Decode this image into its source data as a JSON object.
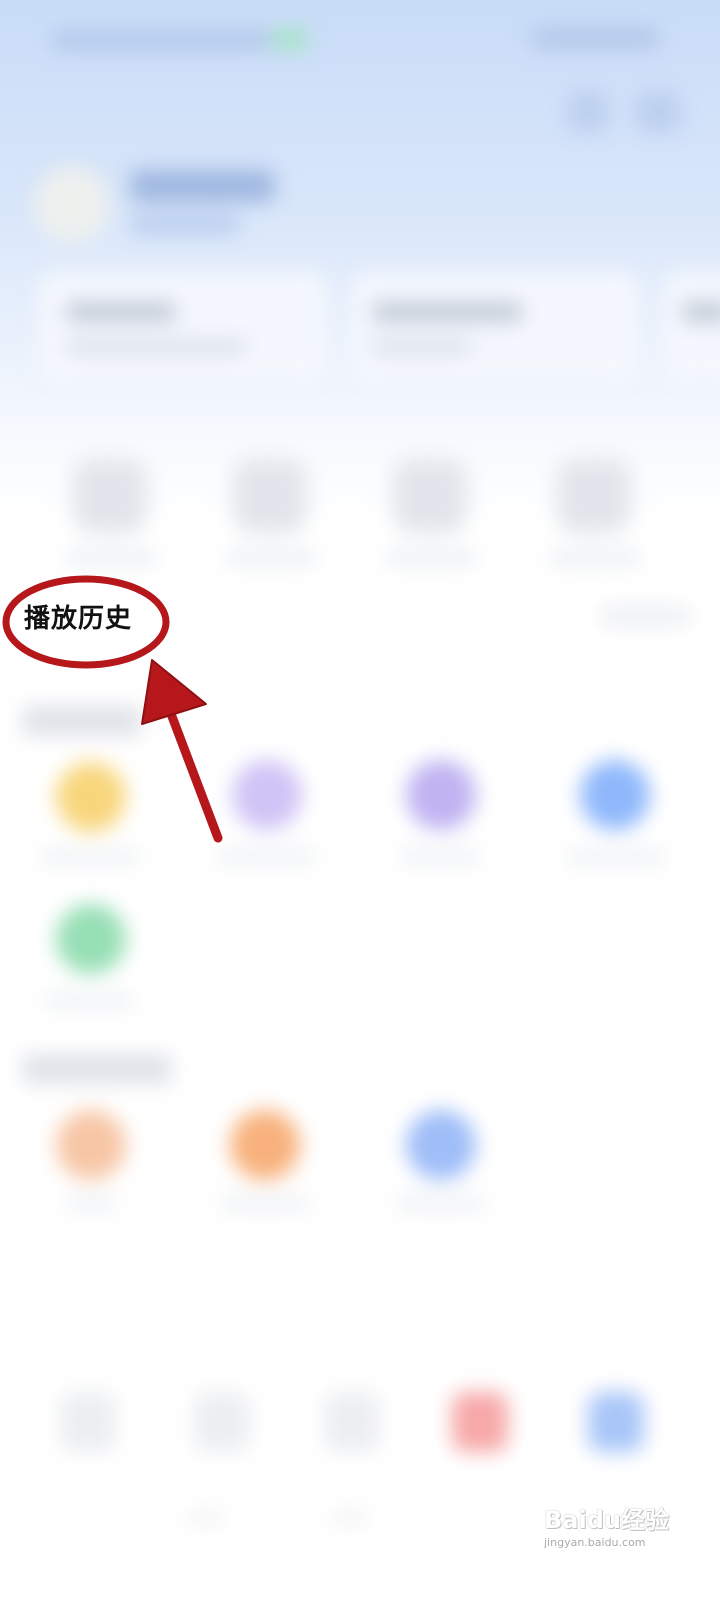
{
  "annotation": {
    "highlighted_label": "播放历史",
    "highlight_color": "#b5171b"
  },
  "watermark": {
    "brand": "Baidu经验",
    "url": "jingyan.baidu.com"
  },
  "blurred_colors": {
    "header_gradient_top": "#c9dcf8",
    "card_bg": "#f4f7fd",
    "icon_yellow": "#f8d67c",
    "icon_purple": "#c6bbf4",
    "icon_blue": "#8fb8fb",
    "icon_green": "#97dfb5",
    "icon_orange": "#f8b17c",
    "nav_red": "#f7a8a8"
  }
}
